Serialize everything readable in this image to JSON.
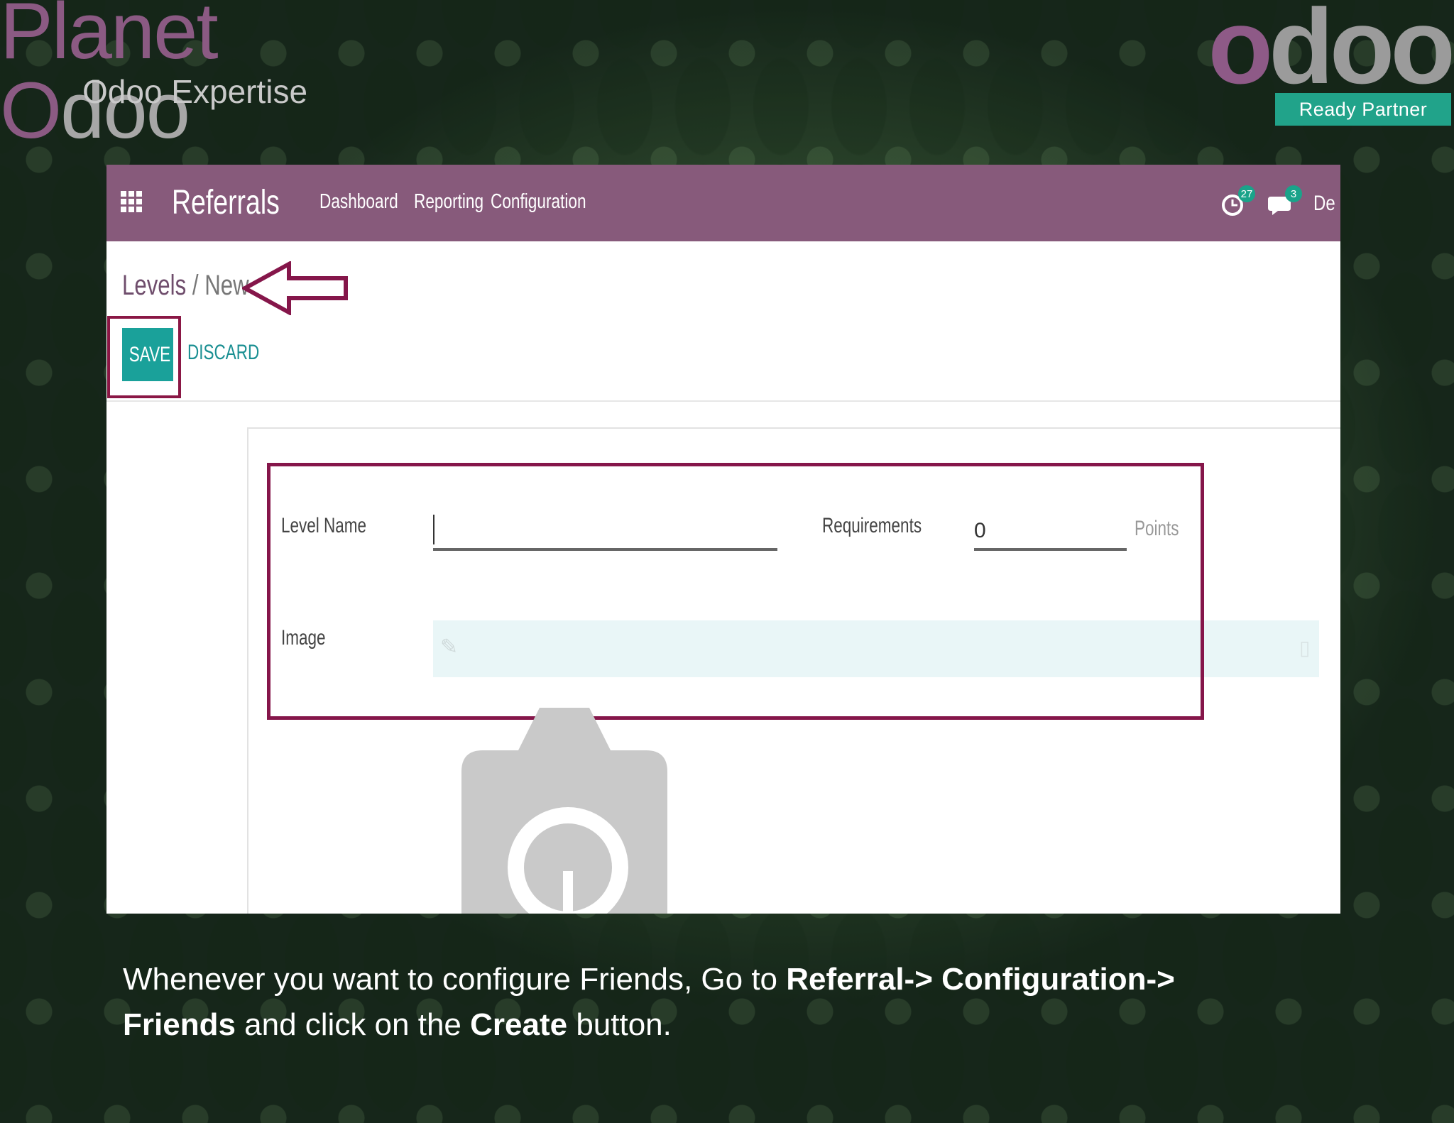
{
  "branding": {
    "left_title_colored": "Planet O",
    "left_title_grey": "doo",
    "left_title_p": "Planet ",
    "left_title_o": "O",
    "left_title_rest": "doo",
    "left_subtitle": "Odoo Expertise",
    "right_logo_first": "o",
    "right_logo_rest": "doo",
    "right_badge": "Ready Partner",
    "colors": {
      "purple": "#875a7b",
      "teal": "#21a38a"
    }
  },
  "app": {
    "name": "Referrals",
    "menu": [
      "Dashboard",
      "Reporting",
      "Configuration"
    ],
    "activity_count": "27",
    "message_count": "3",
    "user_label": "Dem"
  },
  "breadcrumb": {
    "parent": "Levels",
    "separator": "/",
    "current": "New"
  },
  "actions": {
    "save": "SAVE",
    "discard": "DISCARD"
  },
  "form": {
    "level_name_label": "Level Name",
    "level_name_value": "",
    "requirements_label": "Requirements",
    "requirements_value": "0",
    "points_unit": "Points",
    "image_label": "Image"
  },
  "caption": {
    "t1": "Whenever you want to configure Friends, Go to ",
    "b1": "Referral-> Configuration->",
    "b2": "Friends",
    "t2": " and click on the ",
    "b3": "Create",
    "t3": " button."
  }
}
